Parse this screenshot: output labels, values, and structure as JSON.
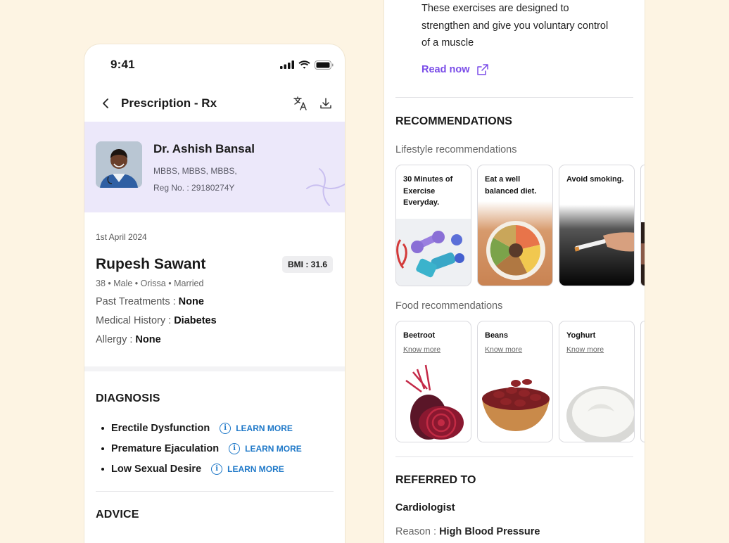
{
  "left": {
    "status": {
      "time": "9:41"
    },
    "nav": {
      "title": "Prescription - Rx"
    },
    "doctor": {
      "name": "Dr. Ashish Bansal",
      "degrees": "MBBS, MBBS, MBBS,",
      "reg": "Reg No. : 29180274Y"
    },
    "patient": {
      "date": "1st April 2024",
      "name": "Rupesh Sawant",
      "bmi": "BMI : 31.6",
      "meta": "38 • Male • Orissa • Married",
      "details": [
        {
          "label": "Past Treatments : ",
          "value": "None"
        },
        {
          "label": "Medical History : ",
          "value": "Diabetes"
        },
        {
          "label": "Allergy : ",
          "value": "None"
        }
      ]
    },
    "diagnosis": {
      "title": "DIAGNOSIS",
      "learn_label": "LEARN MORE",
      "items": [
        "Erectile Dysfunction",
        "Premature Ejaculation",
        "Low Sexual Desire"
      ]
    },
    "advice": {
      "title": "ADVICE"
    }
  },
  "right": {
    "exercise": {
      "text": "These exercises are designed to strengthen and give you voluntary control of a muscle",
      "read_now": "Read now"
    },
    "recommendations": {
      "title": "RECOMMENDATIONS",
      "lifestyle_title": "Lifestyle recommendations",
      "lifestyle": [
        "30 Minutes of Exercise Everyday.",
        "Eat a well balanced diet.",
        "Avoid smoking."
      ],
      "food_title": "Food recommendations",
      "food_know_more": "Know more",
      "food": [
        "Beetroot",
        "Beans",
        "Yoghurt"
      ]
    },
    "referred": {
      "title": "REFERRED TO",
      "specialist": "Cardiologist",
      "reason_label": "Reason : ",
      "reason_value": "High Blood Pressure"
    }
  },
  "colors": {
    "background": "#fdf4e3",
    "doctor_card": "#ece8fa",
    "learn_more": "#1e78c8",
    "read_now": "#7a4ce8"
  }
}
